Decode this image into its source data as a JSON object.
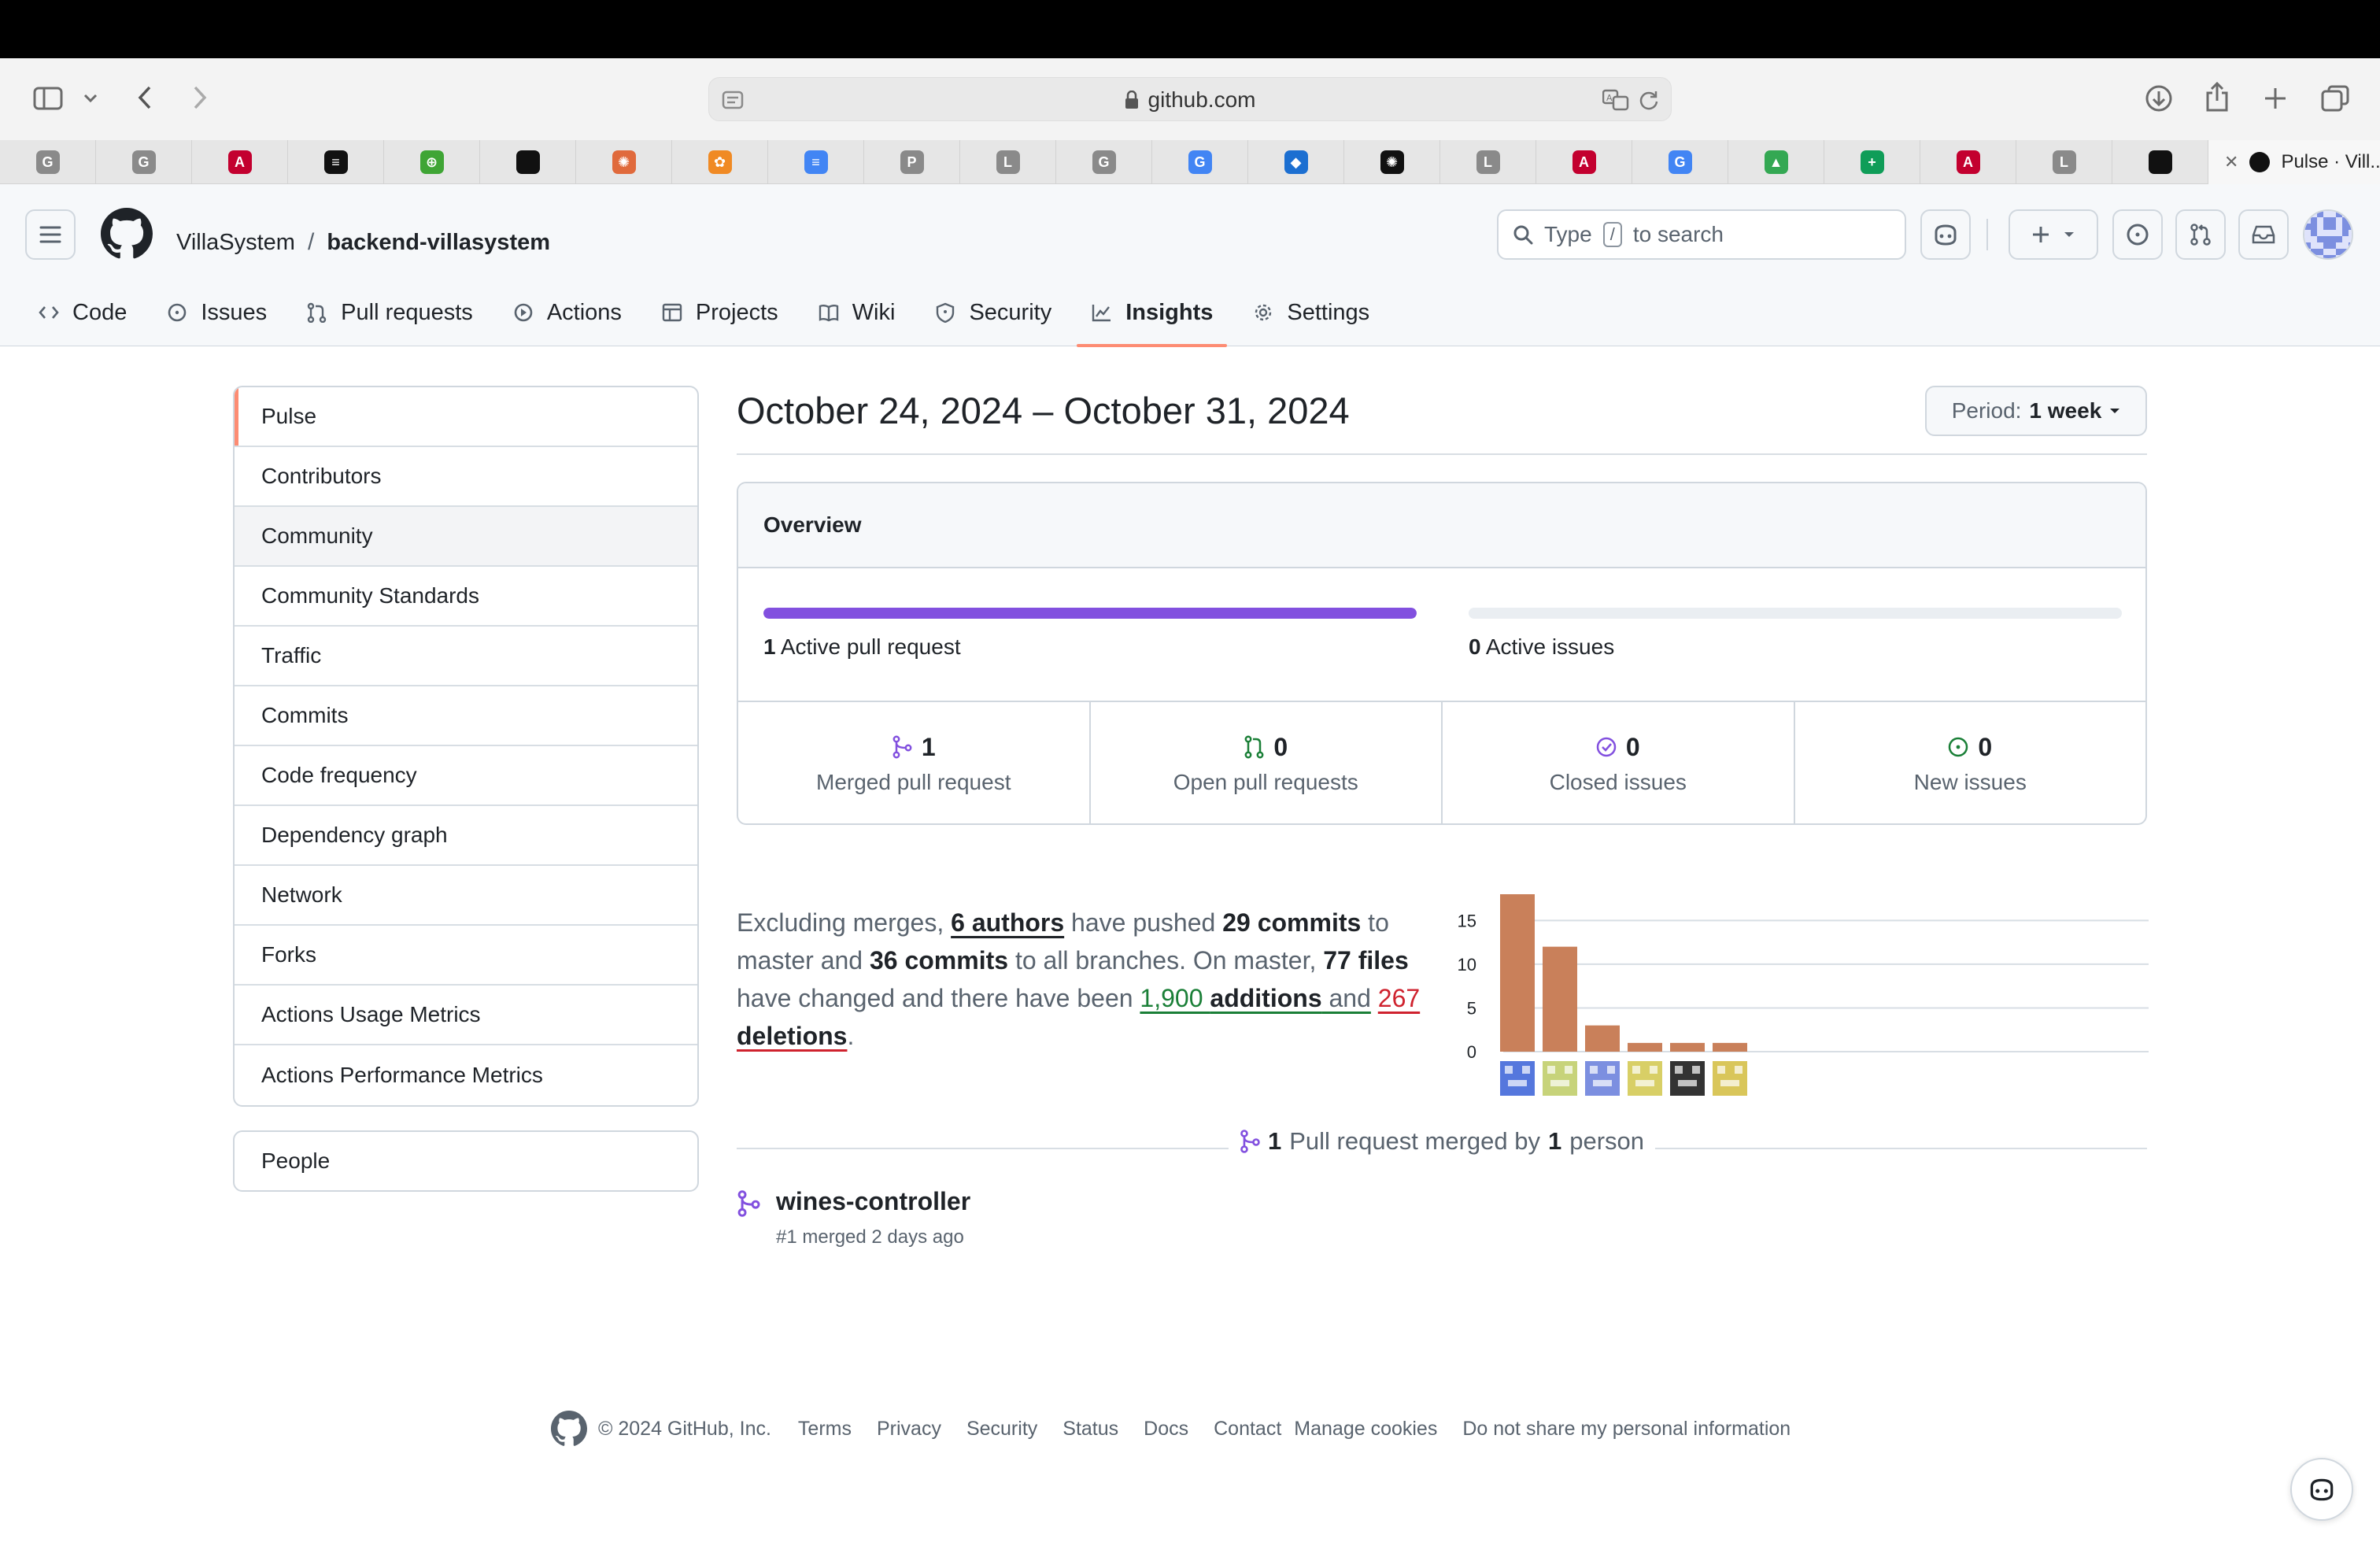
{
  "browser": {
    "url": "github.com",
    "active_tab_title": "Pulse · Vill...",
    "tabs": [
      {
        "icon": "g-letter-favicon",
        "letter": "G",
        "color": "#8a8a8a"
      },
      {
        "icon": "g-letter-favicon",
        "letter": "G",
        "color": "#8a8a8a"
      },
      {
        "icon": "angular-favicon",
        "letter": "A",
        "color": "#c3002f"
      },
      {
        "icon": "circle-logo-favicon",
        "letter": "≡",
        "color": "#111111"
      },
      {
        "icon": "green-globe-favicon",
        "letter": "⊕",
        "color": "#3fa535"
      },
      {
        "icon": "github-favicon",
        "letter": "",
        "color": "#111111"
      },
      {
        "icon": "colorful-wheel-favicon",
        "letter": "✺",
        "color": "#e06a3c"
      },
      {
        "icon": "orange-flower-favicon",
        "letter": "✿",
        "color": "#f08a24"
      },
      {
        "icon": "google-docs-favicon",
        "letter": "≡",
        "color": "#4285f4"
      },
      {
        "icon": "p-letter-favicon",
        "letter": "P",
        "color": "#8a8a8a"
      },
      {
        "icon": "l-letter-favicon",
        "letter": "L",
        "color": "#8a8a8a"
      },
      {
        "icon": "g-letter-favicon",
        "letter": "G",
        "color": "#8a8a8a"
      },
      {
        "icon": "google-favicon",
        "letter": "G",
        "color": "#4285f4"
      },
      {
        "icon": "blue-cube-favicon",
        "letter": "◆",
        "color": "#1c6fd1"
      },
      {
        "icon": "openai-favicon",
        "letter": "✺",
        "color": "#111111"
      },
      {
        "icon": "l-letter-favicon",
        "letter": "L",
        "color": "#8a8a8a"
      },
      {
        "icon": "angular-favicon",
        "letter": "A",
        "color": "#c3002f"
      },
      {
        "icon": "google-favicon",
        "letter": "G",
        "color": "#4285f4"
      },
      {
        "icon": "google-drive-favicon",
        "letter": "▲",
        "color": "#34a853"
      },
      {
        "icon": "google-sheets-favicon",
        "letter": "+",
        "color": "#0f9d58"
      },
      {
        "icon": "angular-favicon",
        "letter": "A",
        "color": "#c3002f"
      },
      {
        "icon": "l-letter-favicon",
        "letter": "L",
        "color": "#8a8a8a"
      },
      {
        "icon": "github-favicon",
        "letter": "",
        "color": "#111111"
      }
    ]
  },
  "repo": {
    "owner": "VillaSystem",
    "separator": "/",
    "name": "backend-villasystem"
  },
  "search": {
    "prefix": "Type",
    "key": "/",
    "suffix": "to search"
  },
  "nav": [
    {
      "label": "Code",
      "icon": "code-icon",
      "selected": false
    },
    {
      "label": "Issues",
      "icon": "issue-icon",
      "selected": false
    },
    {
      "label": "Pull requests",
      "icon": "pull-request-icon",
      "selected": false
    },
    {
      "label": "Actions",
      "icon": "play-icon",
      "selected": false
    },
    {
      "label": "Projects",
      "icon": "table-icon",
      "selected": false
    },
    {
      "label": "Wiki",
      "icon": "book-icon",
      "selected": false
    },
    {
      "label": "Security",
      "icon": "shield-icon",
      "selected": false
    },
    {
      "label": "Insights",
      "icon": "graph-icon",
      "selected": true
    },
    {
      "label": "Settings",
      "icon": "gear-icon",
      "selected": false
    }
  ],
  "sidebar": {
    "items": [
      {
        "label": "Pulse"
      },
      {
        "label": "Contributors"
      },
      {
        "label": "Community"
      },
      {
        "label": "Community Standards"
      },
      {
        "label": "Traffic"
      },
      {
        "label": "Commits"
      },
      {
        "label": "Code frequency"
      },
      {
        "label": "Dependency graph"
      },
      {
        "label": "Network"
      },
      {
        "label": "Forks"
      },
      {
        "label": "Actions Usage Metrics"
      },
      {
        "label": "Actions Performance Metrics"
      }
    ],
    "people": "People"
  },
  "main": {
    "date_range": "October 24, 2024 – October 31, 2024",
    "period_label": "Period:",
    "period_value": "1 week",
    "overview_title": "Overview",
    "active_prs": {
      "count": "1",
      "label": "Active pull request",
      "fraction": 1.0,
      "color": "#8250df"
    },
    "active_issues": {
      "count": "0",
      "label": "Active issues",
      "fraction": 0.0,
      "color": "#1a7f37"
    },
    "stats": [
      {
        "num": "1",
        "label": "Merged pull request",
        "icon": "merged-pr-icon",
        "color": "#8250df"
      },
      {
        "num": "0",
        "label": "Open pull requests",
        "icon": "open-pr-icon",
        "color": "#1a7f37"
      },
      {
        "num": "0",
        "label": "Closed issues",
        "icon": "closed-issue-icon",
        "color": "#8250df"
      },
      {
        "num": "0",
        "label": "New issues",
        "icon": "new-issue-icon",
        "color": "#1a7f37"
      }
    ],
    "summary": {
      "t1": "Excluding merges, ",
      "authors": "6 authors",
      "t2": " have pushed ",
      "commits_master": "29 commits",
      "t3": " to master and ",
      "commits_all": "36 commits",
      "t4": " to all branches. On master, ",
      "files": "77 files",
      "t5": " have changed and there have been ",
      "additions_num": "1,900",
      "additions_word": "additions",
      "t6": " and",
      "deletions_num": "267",
      "deletions_word": "deletions",
      "t7": "."
    },
    "merged_caption": {
      "count": "1",
      "mid": "Pull request merged by",
      "people": "1",
      "end": "person"
    },
    "pr": {
      "title": "wines-controller",
      "meta": "#1 merged 2 days ago"
    }
  },
  "chart_data": {
    "type": "bar",
    "categories": [
      "author-1",
      "author-2",
      "author-3",
      "author-4",
      "author-5",
      "author-6"
    ],
    "values": [
      18,
      12,
      3,
      1,
      1,
      1
    ],
    "y_ticks": [
      0,
      5,
      10,
      15
    ],
    "ylim": [
      0,
      18
    ],
    "bar_color": "#c9805a",
    "grid": true,
    "avatar_colors": [
      "#5577dd",
      "#c7d37a",
      "#7c8fe0",
      "#d8cf66",
      "#333333",
      "#d9c65a"
    ]
  },
  "footer": {
    "copyright": "© 2024 GitHub, Inc.",
    "links": [
      "Terms",
      "Privacy",
      "Security",
      "Status",
      "Docs",
      "Contact",
      "Manage cookies",
      "Do not share my personal information"
    ]
  }
}
